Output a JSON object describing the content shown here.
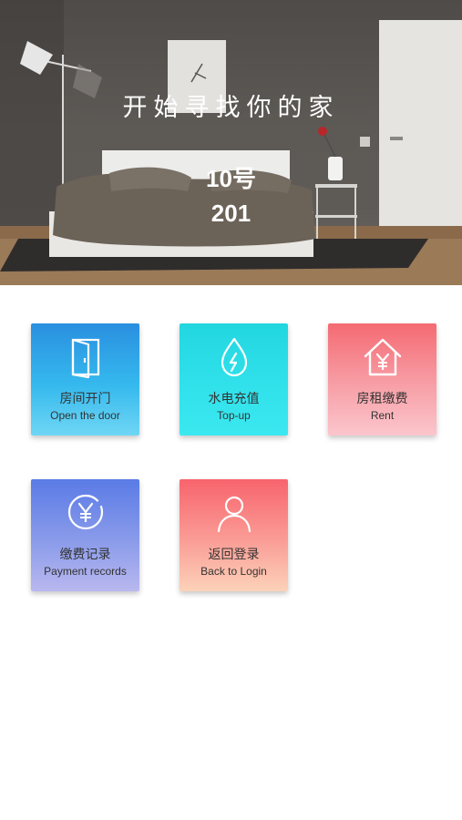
{
  "hero": {
    "slogan": "开始寻找你的家",
    "building": "10号",
    "unit": "201"
  },
  "tiles": [
    {
      "id": "door",
      "label_cn": "房间开门",
      "label_en": "Open the door",
      "icon": "door-icon"
    },
    {
      "id": "topup",
      "label_cn": "水电充值",
      "label_en": "Top-up",
      "icon": "water-drop-bolt-icon"
    },
    {
      "id": "rent",
      "label_cn": "房租缴费",
      "label_en": "Rent",
      "icon": "house-yen-icon"
    },
    {
      "id": "records",
      "label_cn": "缴费记录",
      "label_en": "Payment records",
      "icon": "yen-coin-icon"
    },
    {
      "id": "logout",
      "label_cn": "返回登录",
      "label_en": "Back to Login",
      "icon": "user-icon"
    }
  ],
  "colors": {
    "door": "#2a8fe0",
    "topup": "#22d6df",
    "rent": "#f56a72",
    "records": "#5a7be6",
    "logout": "#f8646d"
  }
}
